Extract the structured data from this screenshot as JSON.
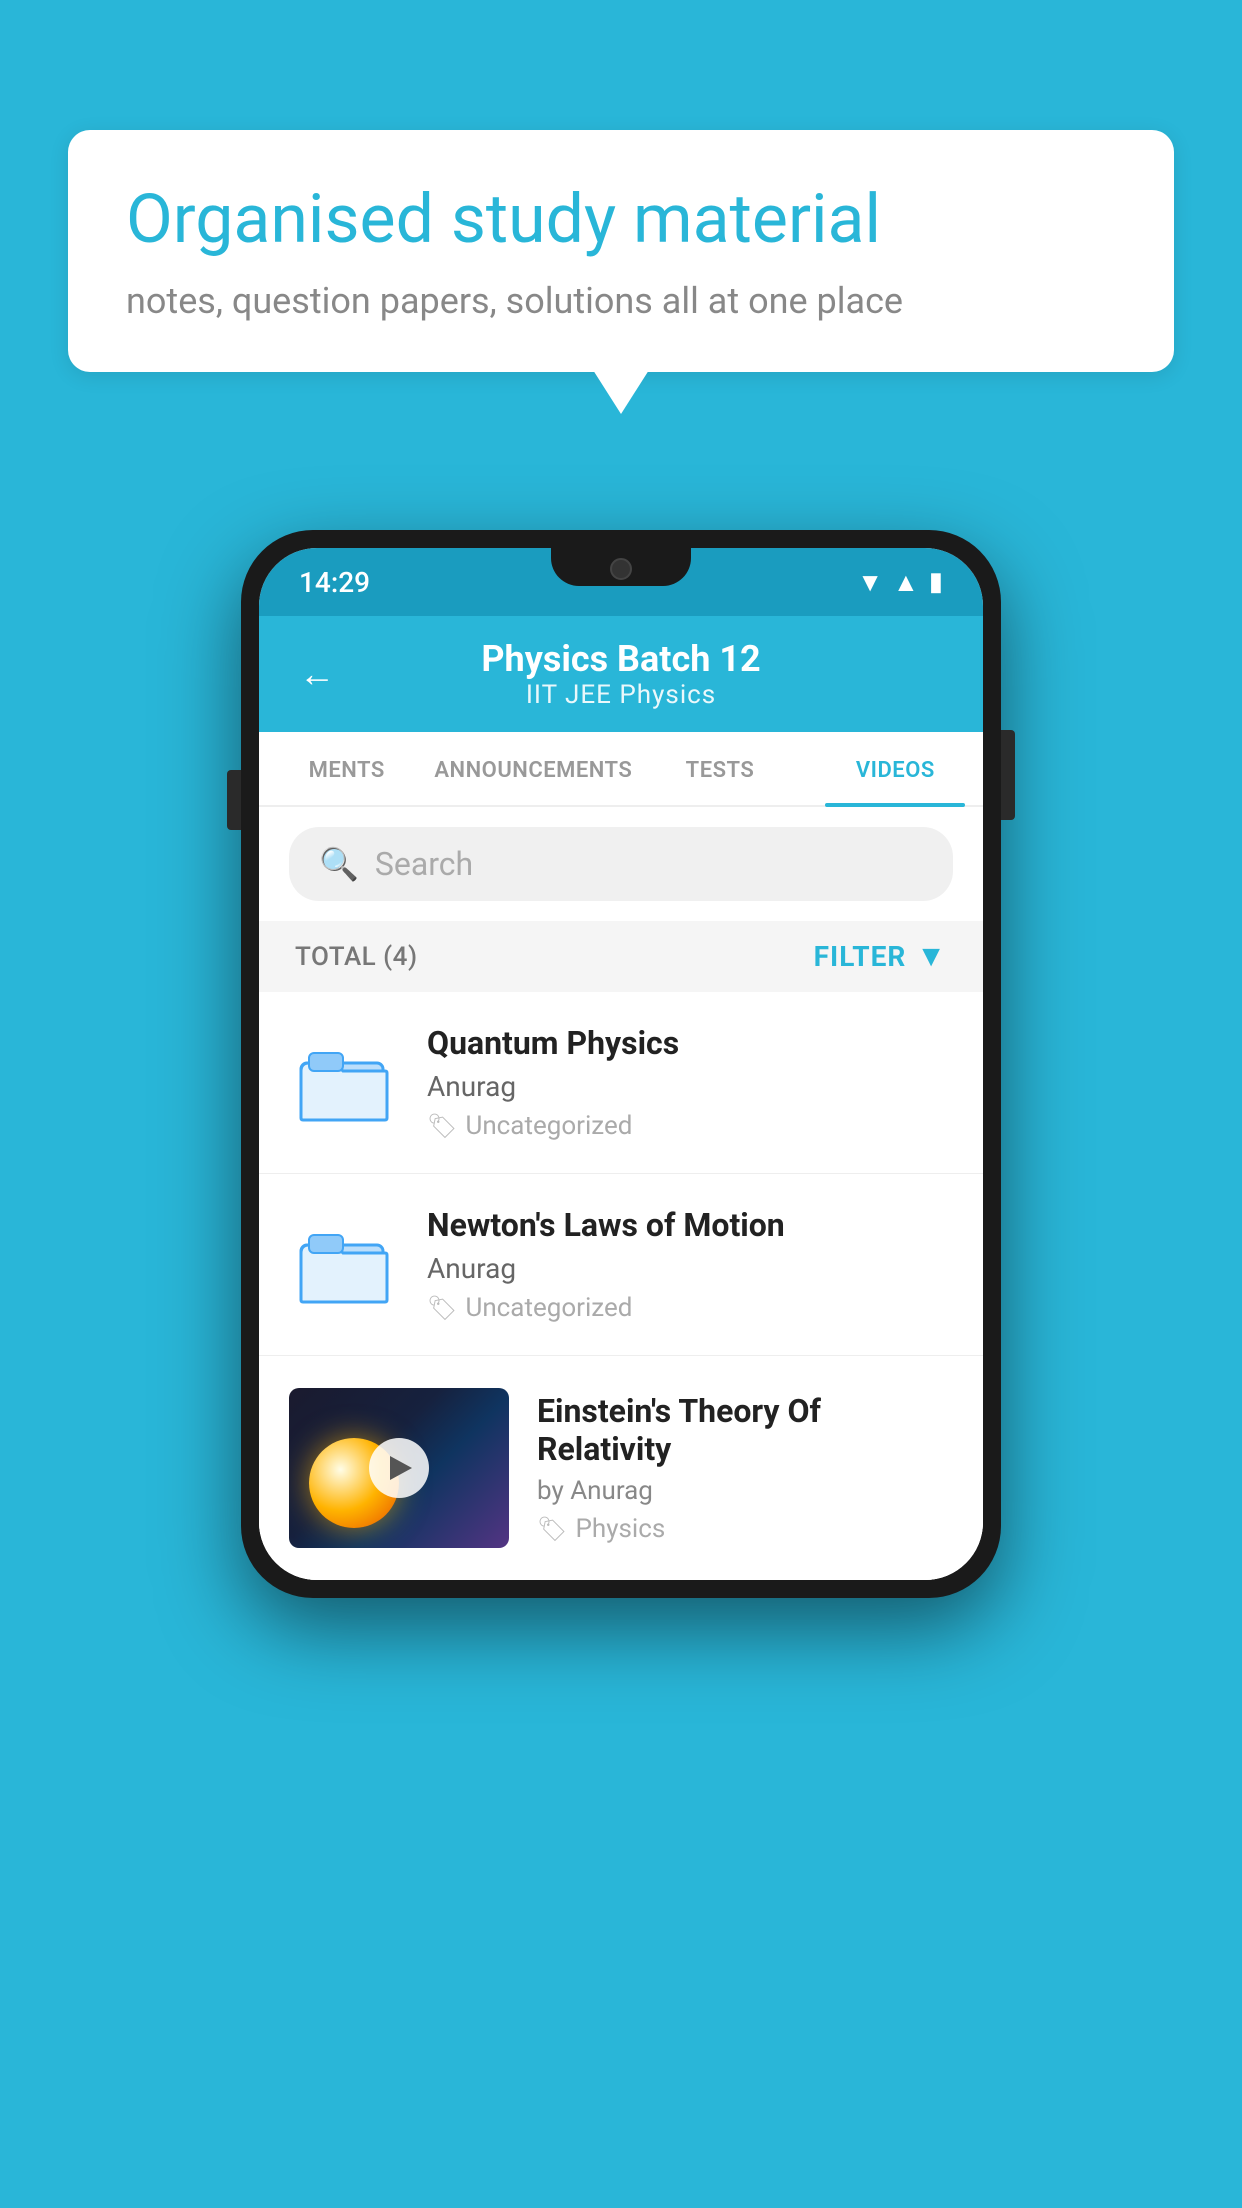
{
  "background": {
    "color": "#29B6D8"
  },
  "speech_bubble": {
    "title": "Organised study material",
    "subtitle": "notes, question papers, solutions all at one place"
  },
  "phone": {
    "status_bar": {
      "time": "14:29"
    },
    "header": {
      "title": "Physics Batch 12",
      "subtitle": "IIT JEE   Physics",
      "back_label": "←"
    },
    "tabs": [
      {
        "label": "MENTS",
        "active": false
      },
      {
        "label": "ANNOUNCEMENTS",
        "active": false
      },
      {
        "label": "TESTS",
        "active": false
      },
      {
        "label": "VIDEOS",
        "active": true
      }
    ],
    "search": {
      "placeholder": "Search"
    },
    "filter": {
      "total_label": "TOTAL (4)",
      "filter_label": "FILTER"
    },
    "videos": [
      {
        "title": "Quantum Physics",
        "author": "Anurag",
        "tag": "Uncategorized",
        "type": "folder"
      },
      {
        "title": "Newton's Laws of Motion",
        "author": "Anurag",
        "tag": "Uncategorized",
        "type": "folder"
      },
      {
        "title": "Einstein's Theory Of Relativity",
        "author": "by Anurag",
        "tag": "Physics",
        "type": "video"
      }
    ]
  }
}
